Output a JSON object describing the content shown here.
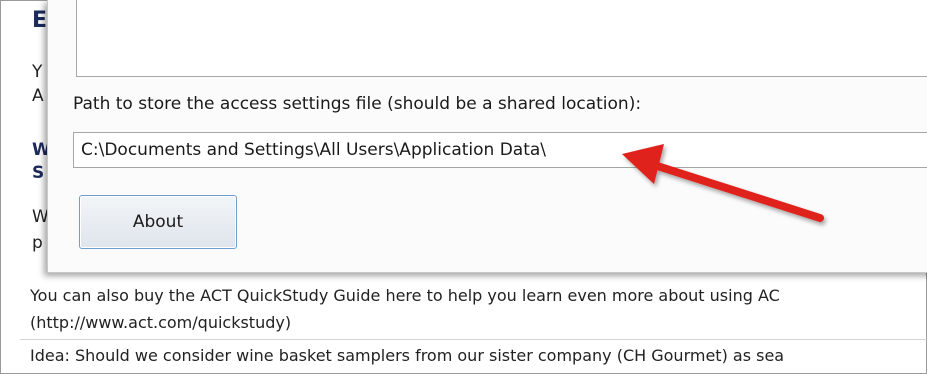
{
  "background": {
    "heading_letter": "E",
    "body_letters": [
      "Y",
      "A"
    ],
    "section_letters": [
      "W",
      "S"
    ],
    "more_letters": [
      "W",
      "p"
    ]
  },
  "dialog": {
    "path_label": "Path to store the access settings file (should be a shared location):",
    "path_value": "C:\\Documents and Settings\\All Users\\Application Data\\",
    "about_button": "About"
  },
  "notes": {
    "line1": "You can also buy the ACT QuickStudy Guide here to help you learn even more about using AC",
    "line2": "(http://www.act.com/quickstudy)",
    "line3": "Idea: Should we consider wine basket samplers from our sister company (CH Gourmet) as sea"
  },
  "colors": {
    "arrow": "#e0201a",
    "button_border": "#6f9fd1"
  }
}
